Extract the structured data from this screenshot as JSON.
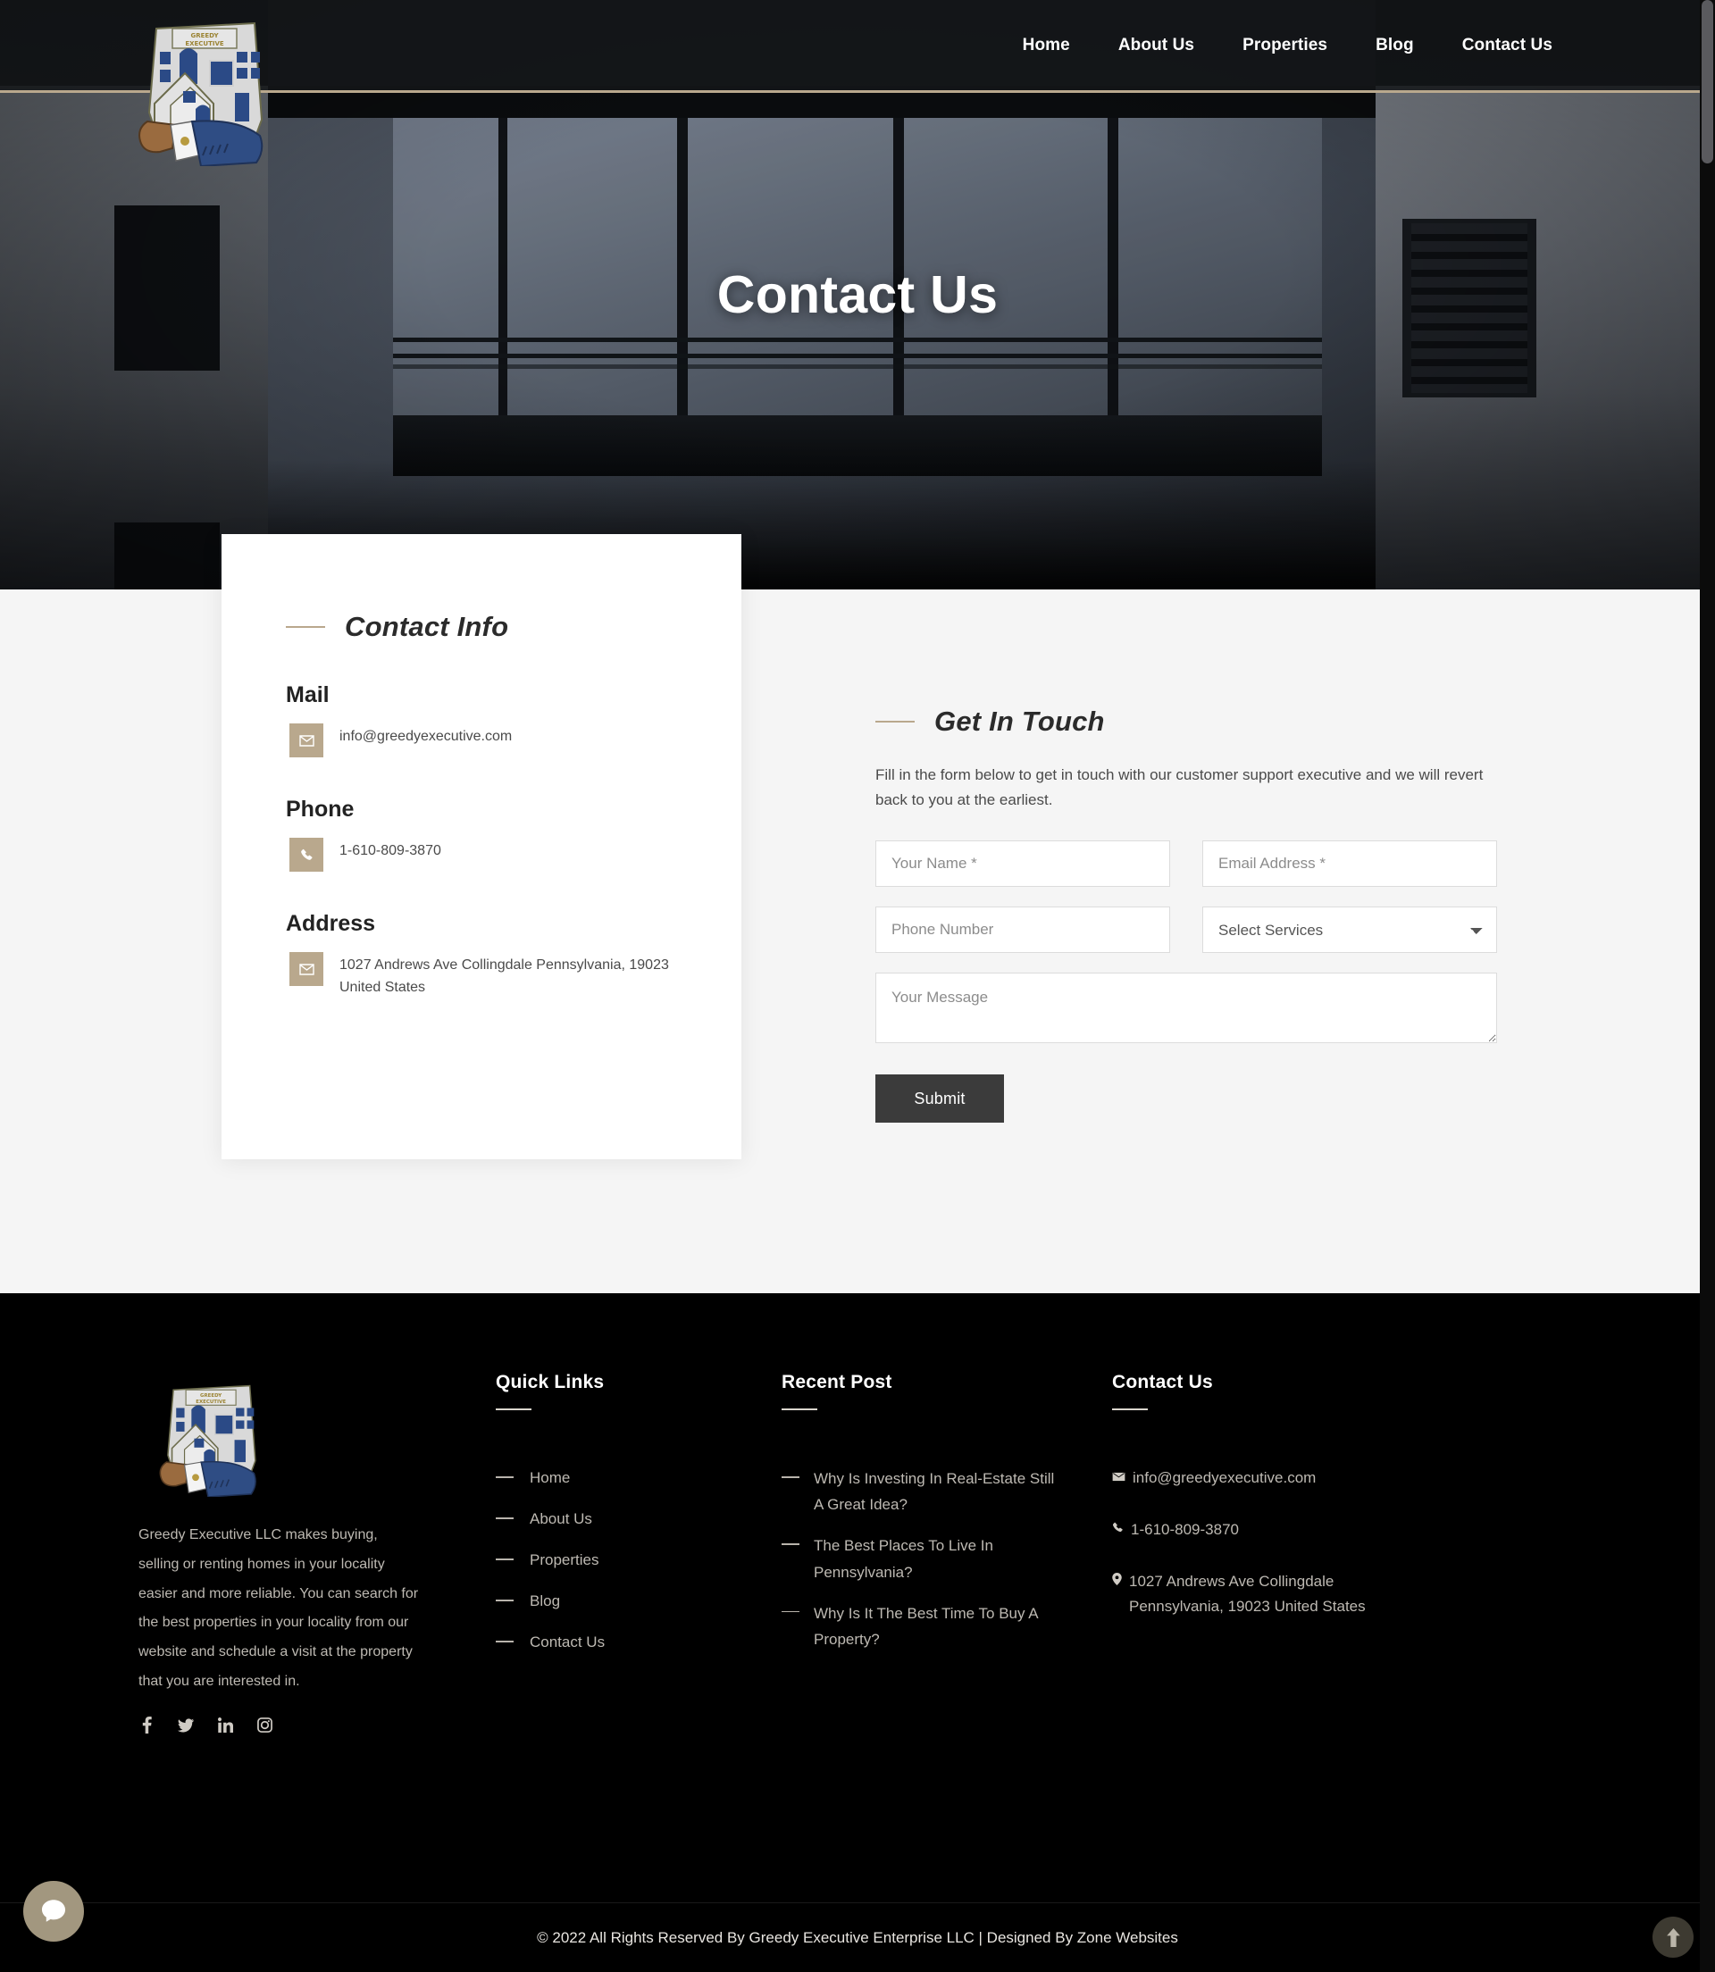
{
  "site": {
    "brand_name": "Greedy Executive",
    "accent_color": "#b9a88d",
    "dark_color": "#000000",
    "button_color": "#3b3b3b"
  },
  "header": {
    "logo_alt": "Greedy Executive logo - hand holding a house",
    "nav": [
      {
        "label": "Home",
        "active": false
      },
      {
        "label": "About Us",
        "active": false
      },
      {
        "label": "Properties",
        "active": false
      },
      {
        "label": "Blog",
        "active": false
      },
      {
        "label": "Contact Us",
        "active": true
      }
    ]
  },
  "hero": {
    "title": "Contact Us"
  },
  "contact_info": {
    "heading": "Contact Info",
    "blocks": [
      {
        "label": "Mail",
        "icon": "envelope-icon",
        "value": "info@greedyexecutive.com"
      },
      {
        "label": "Phone",
        "icon": "phone-icon",
        "value": "1-610-809-3870"
      },
      {
        "label": "Address",
        "icon": "envelope-icon",
        "value": "1027 Andrews Ave Collingdale Pennsylvania, 19023 United States"
      }
    ]
  },
  "get_in_touch": {
    "heading": "Get In Touch",
    "intro": "Fill in the form below to get in touch with our customer support executive and we will revert back to you at the earliest.",
    "fields": {
      "name_placeholder": "Your Name *",
      "name_value": "",
      "email_placeholder": "Email Address *",
      "email_value": "",
      "phone_placeholder": "Phone Number",
      "phone_value": "",
      "services_selected": "Select Services",
      "message_placeholder": "Your Message",
      "message_value": ""
    },
    "submit_label": "Submit"
  },
  "footer": {
    "logo_alt": "Greedy Executive logo - hand holding a house",
    "description": "Greedy Executive LLC makes buying, selling or renting homes in your locality easier and more reliable. You can search for the best properties in your locality from our website and schedule a visit at the property that you are interested in.",
    "social": [
      {
        "name": "facebook-icon",
        "label": "f"
      },
      {
        "name": "twitter-icon",
        "label": "t"
      },
      {
        "name": "linkedin-icon",
        "label": "in"
      },
      {
        "name": "instagram-icon",
        "label": "ig"
      }
    ],
    "quick_links": {
      "heading": "Quick Links",
      "items": [
        {
          "label": "Home"
        },
        {
          "label": "About Us"
        },
        {
          "label": "Properties"
        },
        {
          "label": "Blog"
        },
        {
          "label": "Contact Us"
        }
      ]
    },
    "recent_post": {
      "heading": "Recent Post",
      "items": [
        {
          "label": "Why Is Investing In Real-Estate Still A Great Idea?"
        },
        {
          "label": "The Best Places To Live In Pennsylvania?"
        },
        {
          "label": "Why Is It The Best Time To Buy A Property?"
        }
      ]
    },
    "contact": {
      "heading": "Contact Us",
      "email": "info@greedyexecutive.com",
      "phone": "1-610-809-3870",
      "address": "1027 Andrews Ave Collingdale Pennsylvania, 19023 United States"
    },
    "copyright": "© 2022 All Rights Reserved By Greedy Executive Enterprise LLC | Designed By Zone Websites"
  },
  "widgets": {
    "chat_label": "chat-bubble-icon",
    "to_top_label": "scroll-to-top-icon"
  }
}
